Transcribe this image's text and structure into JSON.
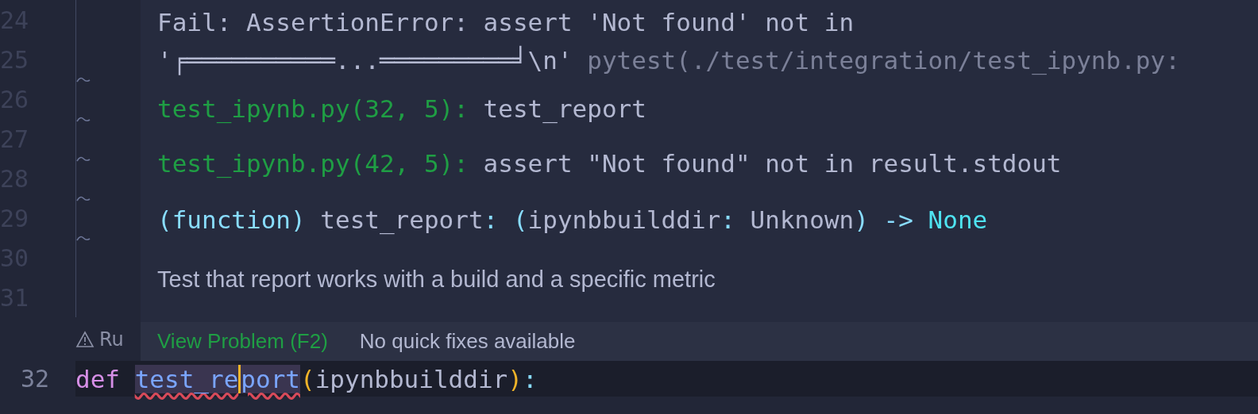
{
  "gutter": {
    "line_numbers": [
      "24",
      "25",
      "26",
      "27",
      "28",
      "29",
      "30",
      "31"
    ],
    "change_marks": [
      false,
      false,
      true,
      true,
      true,
      true,
      true,
      false
    ]
  },
  "hover": {
    "lines": [
      {
        "kind": "mono",
        "parts": [
          {
            "text": "Fail: AssertionError: assert 'Not found' not in",
            "kind": "plain"
          }
        ]
      },
      {
        "kind": "mono",
        "parts": [
          {
            "text": "'╒══════════...═════════╛\\n'",
            "kind": "plain"
          },
          {
            "text": " pytest(./test/integration/test_ipynb.py:",
            "kind": "dim"
          }
        ]
      },
      {
        "kind": "mono",
        "parts": [
          {
            "text": "test_ipynb.py(32, 5):",
            "kind": "link"
          },
          {
            "text": " test_report",
            "kind": "plain"
          }
        ]
      },
      {
        "kind": "mono",
        "parts": [
          {
            "text": "test_ipynb.py(42, 5):",
            "kind": "link"
          },
          {
            "text": " assert \"Not found\" not in result.stdout",
            "kind": "plain"
          }
        ]
      },
      {
        "kind": "mono",
        "parts": [
          {
            "text": "(function)",
            "kind": "keyword"
          },
          {
            "text": " test_report",
            "kind": "plain"
          },
          {
            "text": ": (",
            "kind": "keyword"
          },
          {
            "text": "ipynbbuilddir",
            "kind": "plain"
          },
          {
            "text": ": ",
            "kind": "keyword"
          },
          {
            "text": "Unknown",
            "kind": "plain"
          },
          {
            "text": ") -> ",
            "kind": "keyword"
          },
          {
            "text": "None",
            "kind": "type"
          }
        ]
      },
      {
        "kind": "prose",
        "parts": [
          {
            "text": "Test that report works with a build and a specific metric",
            "kind": "plain"
          }
        ]
      }
    ],
    "status_bar": {
      "action": "View Problem (F2)",
      "message": "No quick fixes available"
    }
  },
  "codelens": "Ru",
  "code_line": {
    "number": "32",
    "tokens": [
      {
        "kind": "keyword",
        "text": "def",
        "error": false,
        "highlighted": false
      },
      {
        "kind": "function",
        "text": "test_re",
        "error": true,
        "highlighted": true
      },
      {
        "kind": "caret"
      },
      {
        "kind": "function",
        "text": "port",
        "error": true,
        "highlighted": true
      },
      {
        "kind": "paren",
        "text": "(",
        "error": false,
        "highlighted": false
      },
      {
        "kind": "param",
        "text": "ipynbbuilddir",
        "error": false,
        "highlighted": false
      },
      {
        "kind": "paren",
        "text": ")",
        "error": false,
        "highlighted": false
      },
      {
        "kind": "punct",
        "text": ":",
        "error": false,
        "highlighted": false
      }
    ]
  }
}
